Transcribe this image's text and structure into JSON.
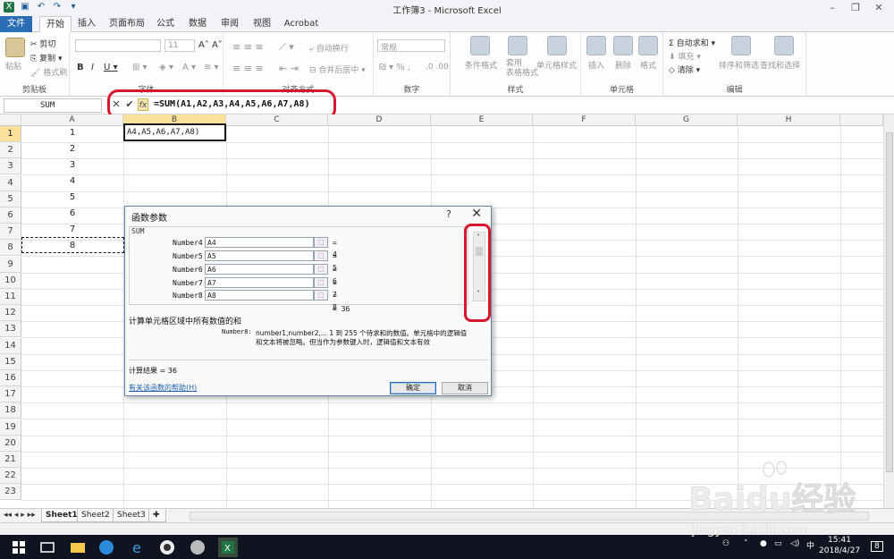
{
  "window": {
    "title": "工作簿3 - Microsoft Excel"
  },
  "ribbon": {
    "tabs": [
      "文件",
      "开始",
      "插入",
      "页面布局",
      "公式",
      "数据",
      "审阅",
      "视图",
      "Acrobat"
    ],
    "clipboard": {
      "paste": "粘贴",
      "cut": "剪切",
      "copy": "复制",
      "format_painter": "格式刷",
      "label": "剪贴板"
    },
    "font": {
      "size": "11",
      "label": "字体"
    },
    "alignment": {
      "wrap": "自动换行",
      "merge": "合并后居中",
      "label": "对齐方式"
    },
    "number": {
      "format": "常规",
      "label": "数字"
    },
    "styles": {
      "conditional": "条件格式",
      "table": "套用\n表格格式",
      "cell": "单元格样式",
      "label": "样式"
    },
    "cells": {
      "insert": "插入",
      "delete": "删除",
      "format": "格式",
      "label": "单元格"
    },
    "editing": {
      "autosum": "自动求和",
      "fill": "填充",
      "clear": "清除",
      "sort": "排序和筛选",
      "find": "查找和选择",
      "label": "编辑"
    }
  },
  "formula_bar": {
    "name_box": "SUM",
    "formula": "=SUM(A1,A2,A3,A4,A5,A6,A7,A8)",
    "fx": "fx"
  },
  "grid": {
    "columns": [
      "A",
      "B",
      "C",
      "D",
      "E",
      "F",
      "G",
      "H"
    ],
    "rows": [
      "1",
      "2",
      "3",
      "4",
      "5",
      "6",
      "7",
      "8",
      "9",
      "10",
      "11",
      "12",
      "13",
      "14",
      "15",
      "16",
      "17",
      "18",
      "19",
      "20",
      "21",
      "22",
      "23"
    ],
    "colA_values": [
      "1",
      "2",
      "3",
      "4",
      "5",
      "6",
      "7",
      "8"
    ],
    "active_cell_text": "A4,A5,A6,A7,A8)"
  },
  "dialog": {
    "title": "函数参数",
    "help": "?",
    "close": "✕",
    "function_name": "SUM",
    "args": [
      {
        "name": "Number4",
        "ref": "A4",
        "value": "= 4"
      },
      {
        "name": "Number5",
        "ref": "A5",
        "value": "= 5"
      },
      {
        "name": "Number6",
        "ref": "A6",
        "value": "= 6"
      },
      {
        "name": "Number7",
        "ref": "A7",
        "value": "= 7"
      },
      {
        "name": "Number8",
        "ref": "A8",
        "value": "= 8"
      }
    ],
    "total": "= 36",
    "description": "计算单元格区域中所有数值的和",
    "arg_help_label": "Number8:",
    "arg_help_line1": "number1,number2,... 1 到 255 个待求和的数值。单元格中的逻辑值",
    "arg_help_line2": "和文本将被忽略。但当作为参数键入时，逻辑值和文本有效",
    "result": "计算结果 = 36",
    "help_link": "有关该函数的帮助(H)",
    "ok": "确定",
    "cancel": "取消"
  },
  "sheets": [
    "Sheet1",
    "Sheet2",
    "Sheet3"
  ],
  "taskbar": {
    "time": "15:41",
    "date": "2018/4/27",
    "ime": "中",
    "notifications": "8"
  },
  "watermark": {
    "brand": "Baidu经验",
    "url": "jingyan.baidu.com"
  }
}
